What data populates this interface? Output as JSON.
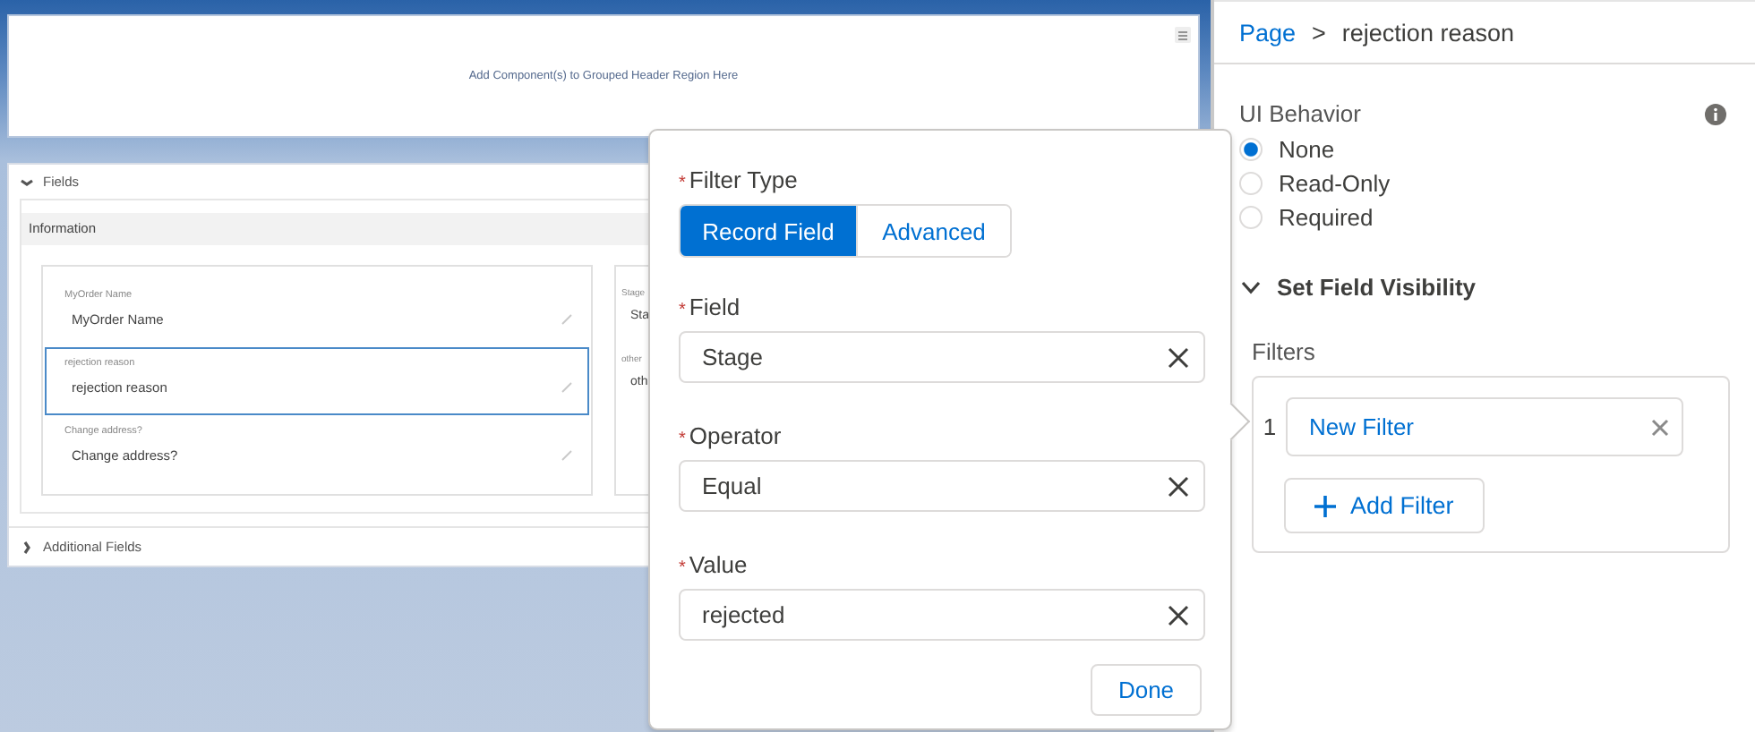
{
  "canvas": {
    "header_region": {
      "text": "Add Component(s) to Grouped Header Region Here"
    },
    "sections": [
      {
        "title": "Fields",
        "expanded": true,
        "cards": [
          {
            "title": "Information",
            "columns": [
              [
                {
                  "label": "MyOrder Name",
                  "value": "MyOrder Name",
                  "selected": false
                },
                {
                  "label": "rejection reason",
                  "value": "rejection reason",
                  "selected": true
                },
                {
                  "label": "Change address?",
                  "value": "Change address?",
                  "selected": false
                }
              ],
              [
                {
                  "label": "Stage",
                  "value": "Sta",
                  "selected": false
                },
                {
                  "label": "other",
                  "value": "oth",
                  "selected": false
                }
              ]
            ]
          }
        ]
      },
      {
        "title": "Additional Fields",
        "expanded": false
      }
    ]
  },
  "popover": {
    "filter_type": {
      "required_mark": "*",
      "label": "Filter Type",
      "options": [
        {
          "label": "Record Field",
          "selected": true
        },
        {
          "label": "Advanced",
          "selected": false
        }
      ]
    },
    "fields": [
      {
        "required_mark": "*",
        "label": "Field",
        "value": "Stage"
      },
      {
        "required_mark": "*",
        "label": "Operator",
        "value": "Equal"
      },
      {
        "required_mark": "*",
        "label": "Value",
        "value": "rejected"
      }
    ],
    "done": "Done"
  },
  "panel": {
    "breadcrumb": {
      "link": "Page",
      "separator": ">",
      "current": "rejection reason"
    },
    "ui_behavior": {
      "label": "UI Behavior",
      "options": [
        {
          "label": "None",
          "selected": true
        },
        {
          "label": "Read-Only",
          "selected": false
        },
        {
          "label": "Required",
          "selected": false
        }
      ]
    },
    "visibility": {
      "title": "Set Field Visibility",
      "expanded": true,
      "filters_label": "Filters",
      "filters": [
        {
          "number": "1",
          "label": "New Filter"
        }
      ],
      "add_button": "Add Filter"
    }
  }
}
